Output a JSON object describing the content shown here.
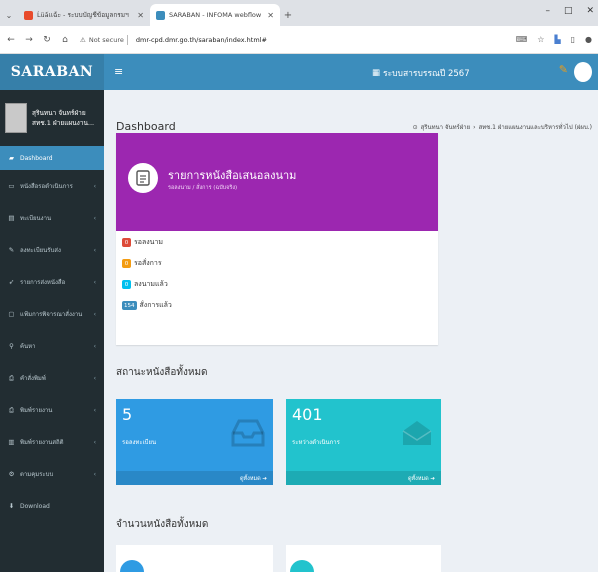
{
  "browser": {
    "tabs": [
      {
        "label": "Ĺüấเเฉ้ะ - ระบบบัญชีข้อมูลกรมฯ",
        "active": false
      },
      {
        "label": "SARABAN - INFOMA webflow",
        "active": true
      }
    ],
    "new_tab": "+",
    "window_controls": [
      "–",
      "□",
      "✕"
    ],
    "not_secure": "Not secure",
    "url": "dmr-cpd.dmr.go.th/saraban/index.html#"
  },
  "app": {
    "logo": "SARABAN",
    "system_title": "ระบบสารบรรณปี 2567",
    "accent_color": "#3c8dbc",
    "sidebar_color": "#222d32"
  },
  "user": {
    "name": "สุรินทนา จันทร์ฝ่าย",
    "dept": "สทช.1 ฝ่ายแผนงาน..."
  },
  "sidebar": {
    "items": [
      {
        "label": "Dashboard",
        "icon": "dashboard-icon",
        "glyph": "▰",
        "active": true,
        "chevron": false
      },
      {
        "label": "หนังสือรอดำเนินการ",
        "icon": "inbox-icon",
        "glyph": "▭",
        "active": false,
        "chevron": true
      },
      {
        "label": "ทะเบียนงาน",
        "icon": "book-icon",
        "glyph": "▤",
        "active": false,
        "chevron": true
      },
      {
        "label": "ลงทะเบียนรับส่ง",
        "icon": "edit-icon",
        "glyph": "✎",
        "active": false,
        "chevron": true
      },
      {
        "label": "รายการส่งหนังสือ",
        "icon": "send-icon",
        "glyph": "➶",
        "active": false,
        "chevron": true
      },
      {
        "label": "แฟ้มการพิจารณาสั่งงาน",
        "icon": "folder-icon",
        "glyph": "▢",
        "active": false,
        "chevron": true
      },
      {
        "label": "ค้นหา",
        "icon": "search-icon",
        "glyph": "⚲",
        "active": false,
        "chevron": true
      },
      {
        "label": "คำสั่งพิมพ์",
        "icon": "print-icon",
        "glyph": "⎙",
        "active": false,
        "chevron": true
      },
      {
        "label": "พิมพ์รายงาน",
        "icon": "report-icon",
        "glyph": "⎙",
        "active": false,
        "chevron": true
      },
      {
        "label": "พิมพ์รายงานสถิติ",
        "icon": "chart-icon",
        "glyph": "▥",
        "active": false,
        "chevron": true
      },
      {
        "label": "ตามคุมระบบ",
        "icon": "gear-icon",
        "glyph": "⚙",
        "active": false,
        "chevron": true
      },
      {
        "label": "Download",
        "icon": "download-icon",
        "glyph": "⬇",
        "active": false,
        "chevron": false
      }
    ]
  },
  "page": {
    "title": "Dashboard",
    "breadcrumb": [
      "สุรินทนา จันทร์ฝ่าย",
      "สทช.1 ฝ่ายแผนงานและบริหารทั่วไป (ฝผบ.)"
    ]
  },
  "approval_box": {
    "title": "รายการหนังสือเสนอลงนาม",
    "subtitle": "รอลงนาม / สั่งการ (ฉบับจริง)",
    "color": "#9c27b0",
    "items": [
      {
        "count": "0",
        "label": "รอลงนาม",
        "color": "#dd4b39"
      },
      {
        "count": "0",
        "label": "รอสั่งการ",
        "color": "#f39c12"
      },
      {
        "count": "0",
        "label": "ลงนามแล้ว",
        "color": "#00c0ef"
      },
      {
        "count": "154",
        "label": "สั่งการแล้ว",
        "color": "#3c8dbc"
      }
    ]
  },
  "status_section": {
    "title": "สถานะหนังสือทั้งหมด",
    "cards": [
      {
        "value": "5",
        "label": "รอลงทะเบียน",
        "more": "ดูทั้งหมด ➔",
        "color": "#2f9be3",
        "icon": "inbox-tray-icon"
      },
      {
        "value": "401",
        "label": "ระหว่างดำเนินการ",
        "more": "ดูทั้งหมด ➔",
        "color": "#22c3cd",
        "icon": "envelope-icon"
      }
    ]
  },
  "count_section": {
    "title": "จำนวนหนังสือทั้งหมด",
    "cards": [
      {
        "color": "#2f9be3"
      },
      {
        "color": "#22c3cd"
      }
    ]
  }
}
